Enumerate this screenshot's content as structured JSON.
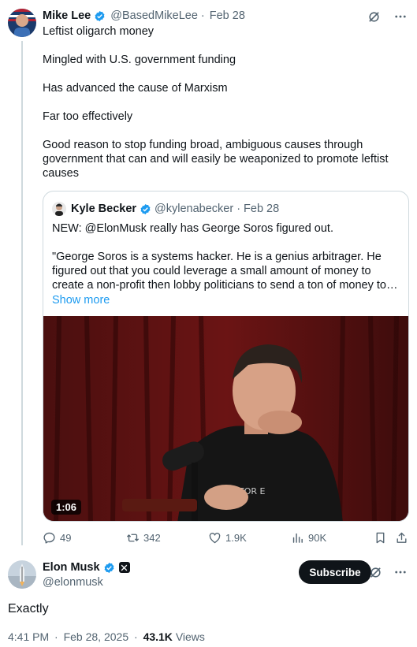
{
  "main_tweet": {
    "author_name": "Mike Lee",
    "handle": "@BasedMikeLee",
    "separator": "·",
    "date": "Feb 28",
    "paragraphs": [
      "Leftist oligarch money",
      "Mingled with U.S. government funding",
      "Has advanced the cause of Marxism",
      "Far too effectively",
      "Good reason to stop funding broad, ambiguous causes through government that can and will easily be weaponized to promote leftist causes"
    ]
  },
  "quoted_tweet": {
    "author_name": "Kyle Becker",
    "handle": "@kylenabecker",
    "separator": "·",
    "date": "Feb 28",
    "lead": "NEW: @ElonMusk really has George Soros figured out.",
    "body": "\"George Soros is a systems hacker. He is a genius arbitrager. He figured out that you could leverage a small amount of money to create a non-profit then lobby politicians to send a ton of money to that non profit so that the non profit can do their bidding.",
    "show_more": "Show more",
    "video_duration": "1:06"
  },
  "actions": {
    "replies": "49",
    "reposts": "342",
    "likes": "1.9K",
    "views": "90K"
  },
  "reply_tweet": {
    "author_name": "Elon Musk",
    "handle": "@elonmusk",
    "subscribe_label": "Subscribe",
    "text": "Exactly",
    "time": "4:41 PM",
    "separator": "·",
    "date": "Feb 28, 2025",
    "views_count": "43.1K",
    "views_label": "Views"
  },
  "colors": {
    "text": "#0f1419",
    "muted": "#536471",
    "verified_blue": "#1d9bf0",
    "link": "#1d9bf0",
    "border": "#cfd9de",
    "subscribe_bg": "#0f1419"
  },
  "icons": [
    "verified-badge-icon",
    "grok-icon",
    "more-icon",
    "reply-icon",
    "repost-icon",
    "like-icon",
    "views-icon",
    "bookmark-icon",
    "share-icon",
    "affiliate-x-icon"
  ]
}
